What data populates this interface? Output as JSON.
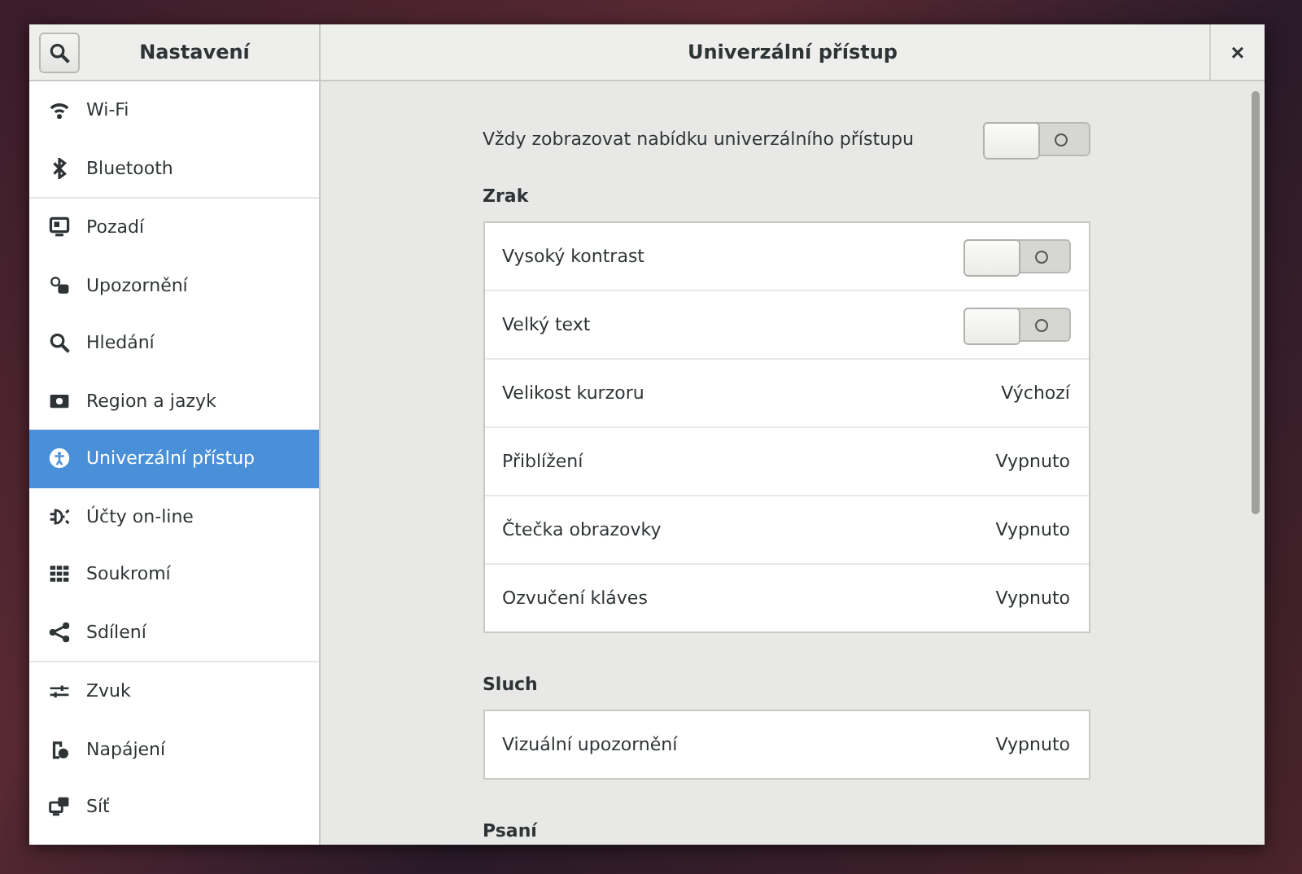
{
  "sidebar": {
    "title": "Nastavení",
    "groups": [
      {
        "items": [
          {
            "label": "Wi-Fi",
            "selected": false
          },
          {
            "label": "Bluetooth",
            "selected": false
          }
        ]
      },
      {
        "items": [
          {
            "label": "Pozadí",
            "selected": false
          },
          {
            "label": "Upozornění",
            "selected": false
          },
          {
            "label": "Hledání",
            "selected": false
          },
          {
            "label": "Region a jazyk",
            "selected": false
          },
          {
            "label": "Univerzální přístup",
            "selected": true
          },
          {
            "label": "Účty on-line",
            "selected": false
          },
          {
            "label": "Soukromí",
            "selected": false
          },
          {
            "label": "Sdílení",
            "selected": false
          }
        ]
      },
      {
        "items": [
          {
            "label": "Zvuk",
            "selected": false
          },
          {
            "label": "Napájení",
            "selected": false
          },
          {
            "label": "Síť",
            "selected": false
          }
        ]
      }
    ]
  },
  "window": {
    "title": "Univerzální přístup",
    "close": "×"
  },
  "top_row": {
    "label": "Vždy zobrazovat nabídku univerzálního přístupu",
    "on": false
  },
  "sections": [
    {
      "title": "Zrak",
      "rows": [
        {
          "kind": "switch",
          "label": "Vysoký kontrast",
          "on": false
        },
        {
          "kind": "switch",
          "label": "Velký text",
          "on": false
        },
        {
          "kind": "value",
          "label": "Velikost kurzoru",
          "value": "Výchozí"
        },
        {
          "kind": "value",
          "label": "Přiblížení",
          "value": "Vypnuto"
        },
        {
          "kind": "value",
          "label": "Čtečka obrazovky",
          "value": "Vypnuto"
        },
        {
          "kind": "value",
          "label": "Ozvučení kláves",
          "value": "Vypnuto"
        }
      ]
    },
    {
      "title": "Sluch",
      "rows": [
        {
          "kind": "value",
          "label": "Vizuální upozornění",
          "value": "Vypnuto"
        }
      ]
    },
    {
      "title": "Psaní"
    }
  ]
}
